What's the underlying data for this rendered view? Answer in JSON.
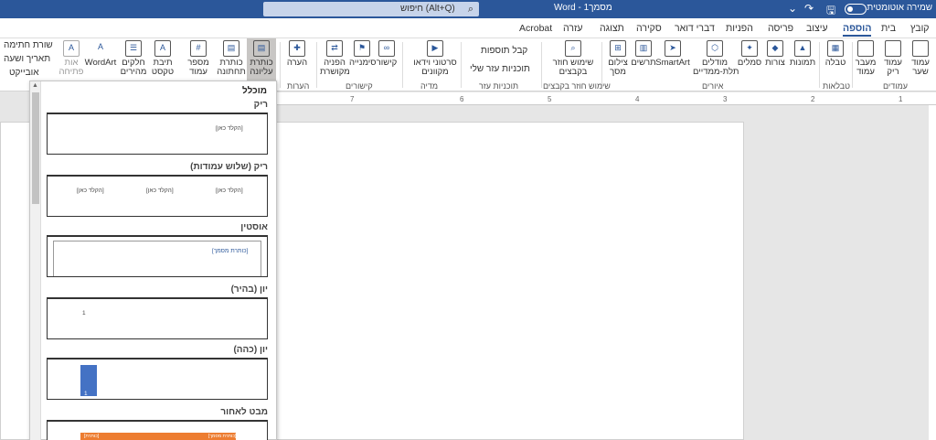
{
  "titlebar": {
    "search": "חיפוש (Alt+Q)",
    "document": "מסמך1 - Word",
    "autosave": "שמירה אוטומטית"
  },
  "tabs": [
    "קובץ",
    "בית",
    "הוספה",
    "עיצוב",
    "פריסה",
    "הפניות",
    "דברי דואר",
    "סקירה",
    "תצוגה",
    "עזרה",
    "Acrobat"
  ],
  "active_tab": "הוספה",
  "ribbon": {
    "pages": {
      "cover": "עמוד\nשער",
      "blank": "עמוד\nריק",
      "break": "מעבר\nעמוד",
      "group": "עמודים"
    },
    "tables": {
      "table": "טבלה",
      "group": "טבלאות"
    },
    "illustrations": {
      "pictures": "תמונות",
      "shapes": "צורות",
      "icons": "סמלים",
      "models": "מודלים\nתלת-ממדיים",
      "smartart": "SmartArt",
      "chart": "תרשים",
      "screenshot": "צילום\nמסך",
      "group": "איורים"
    },
    "reuse": {
      "reuse_files": "שימוש חוזר\nבקבצים",
      "group": "שימוש חוזר בקבצים"
    },
    "addins": {
      "get": "קבל תוספות",
      "my": "תוכניות עזר שלי",
      "group": "תוכניות עזר"
    },
    "media": {
      "video": "סרטוני וידאו\nמקוונים",
      "group": "מדיה"
    },
    "links": {
      "link": "קישור",
      "bookmark": "סימנייה",
      "crossref": "הפניה\nמקושרת",
      "group": "קישורים"
    },
    "comments": {
      "comment": "הערה",
      "group": "הערות"
    },
    "headerfooter": {
      "header": "כותרת\nעליונה",
      "footer": "כותרת\nתחתונה",
      "pagenum": "מספר\nעמוד"
    },
    "text": {
      "textbox": "תיבת\nטקסט",
      "quickparts": "חלקים\nמהירים",
      "wordart": "WordArt",
      "dropcap": "אות\nפתיחה",
      "signature": "שורת חתימה",
      "datetime": "תאריך ושעה",
      "object": "אובייקט"
    }
  },
  "ruler": [
    "1",
    "2",
    "3",
    "4",
    "5",
    "6",
    "7"
  ],
  "gallery": {
    "heading": "מוכלל",
    "items": [
      {
        "name": "ריק",
        "ph": [
          "[הקלד כאן]"
        ]
      },
      {
        "name": "ריק (שלוש עמודות)",
        "ph": [
          "[הקלד כאן]",
          "[הקלד כאן]",
          "[הקלד כאן]"
        ]
      },
      {
        "name": "אוסטין",
        "ph": [
          "[כותרת מסמך]"
        ]
      },
      {
        "name": "יון (בהיר)",
        "ph": [
          "1"
        ]
      },
      {
        "name": "יון (כהה)",
        "ph": [
          "1"
        ]
      },
      {
        "name": "מבט לאחור",
        "ph": [
          "[כותרת]",
          "[כותרת מסמך]"
        ]
      }
    ]
  }
}
